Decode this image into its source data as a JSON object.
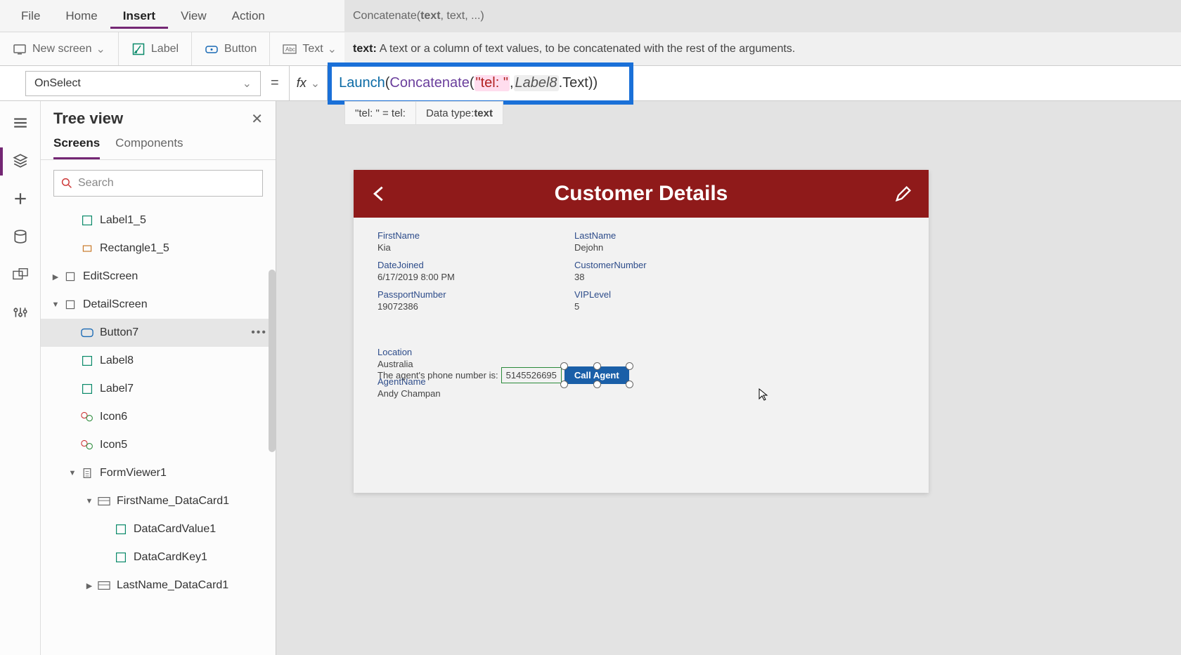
{
  "menu": {
    "file": "File",
    "home": "Home",
    "insert": "Insert",
    "view": "View",
    "action": "Action"
  },
  "ribbon": {
    "newscreen": "New screen",
    "label": "Label",
    "button": "Button",
    "text": "Text"
  },
  "signature": {
    "fn": "Concatenate(",
    "first": "text",
    "rest": ", text, ...)"
  },
  "tooltip": {
    "prefix": "text:",
    "body": " A text or a column of text values, to be concatenated with the rest of the arguments."
  },
  "property": "OnSelect",
  "formula": {
    "launch": "Launch",
    "concat": "Concatenate",
    "str": "\"tel: \"",
    "ident": "Label8",
    "suffix": ".Text"
  },
  "result": {
    "lhs": "\"tel: \"  =  tel:",
    "rhs_label": "Data type: ",
    "rhs_val": "text"
  },
  "tree": {
    "title": "Tree view",
    "tabs": {
      "screens": "Screens",
      "components": "Components"
    },
    "search_placeholder": "Search",
    "nodes": {
      "label1_5": "Label1_5",
      "rect1_5": "Rectangle1_5",
      "editscreen": "EditScreen",
      "detailscreen": "DetailScreen",
      "button7": "Button7",
      "label8": "Label8",
      "label7": "Label7",
      "icon6": "Icon6",
      "icon5": "Icon5",
      "formviewer": "FormViewer1",
      "firstnamecard": "FirstName_DataCard1",
      "dcv1": "DataCardValue1",
      "dck1": "DataCardKey1",
      "lastnamecard": "LastName_DataCard1"
    }
  },
  "app": {
    "title": "Customer Details",
    "fields": {
      "firstname_l": "FirstName",
      "firstname_v": "Kia",
      "lastname_l": "LastName",
      "lastname_v": "Dejohn",
      "location_l": "Location",
      "location_v": "Australia",
      "datejoined_l": "DateJoined",
      "datejoined_v": "6/17/2019 8:00 PM",
      "custnum_l": "CustomerNumber",
      "custnum_v": "38",
      "agentname_l": "AgentName",
      "agentname_v": "Andy Champan",
      "passport_l": "PassportNumber",
      "passport_v": "19072386",
      "vip_l": "VIPLevel",
      "vip_v": "5"
    },
    "agent_text": "The agent's phone number is:",
    "agent_phone": "5145526695",
    "call_btn": "Call Agent"
  }
}
